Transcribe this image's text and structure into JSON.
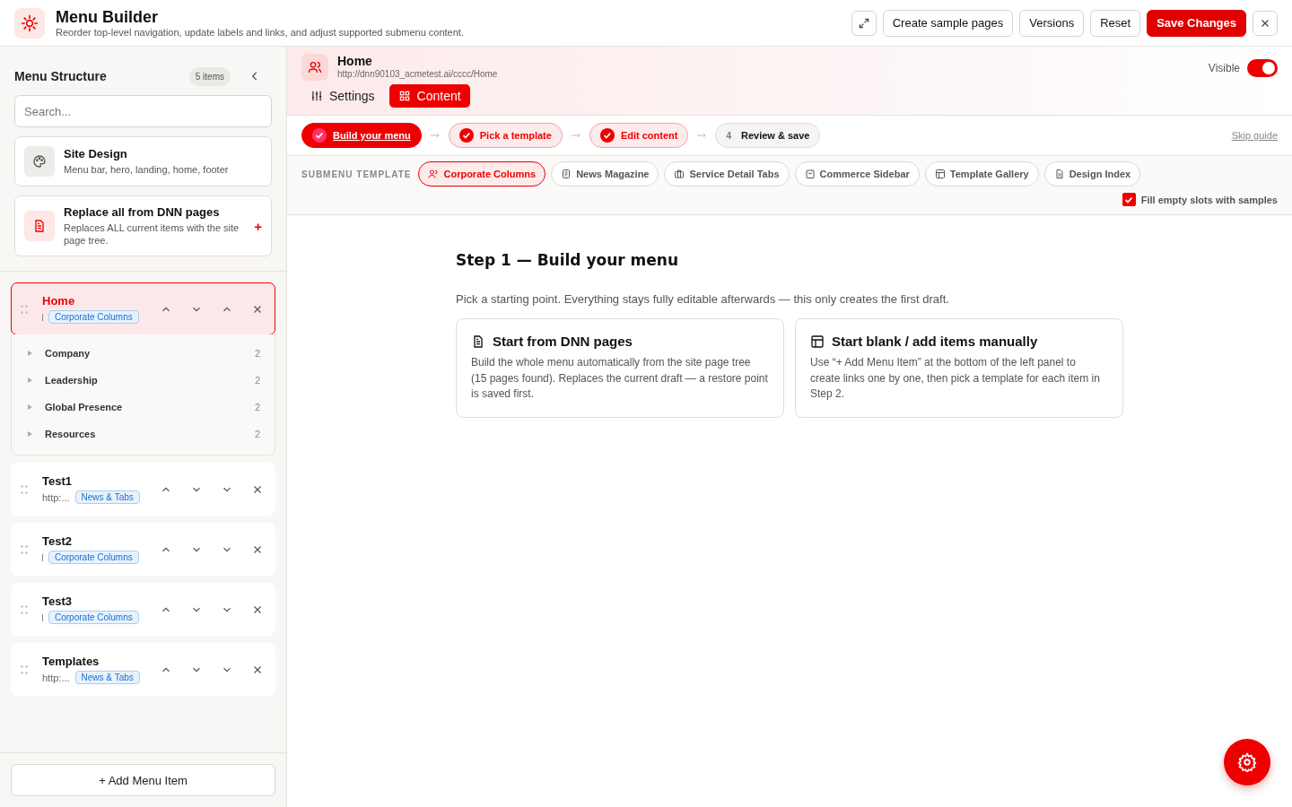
{
  "header": {
    "title": "Menu Builder",
    "subtitle": "Reorder top-level navigation, update labels and links, and adjust supported submenu content.",
    "buttons": [
      {
        "label": "Create sample pages",
        "kind": "plain"
      },
      {
        "label": "Versions",
        "kind": "plain"
      },
      {
        "label": "Reset",
        "kind": "plain"
      },
      {
        "label": "Save Changes",
        "kind": "primary"
      }
    ]
  },
  "sidebar": {
    "title": "Menu Structure",
    "count": "5 items",
    "search": {
      "placeholder": "Search..."
    },
    "cards": [
      {
        "title": "Site Design",
        "text": "Menu bar, hero, landing, home, footer",
        "kind": "design"
      },
      {
        "title": "Replace all from DNN pages",
        "text": "Replaces ALL current items with the site page tree.",
        "kind": "replace",
        "action": "+"
      }
    ],
    "items": [
      {
        "label": "Home",
        "template": "Corporate Columns",
        "selected": true,
        "expanded": true,
        "children": [
          {
            "label": "Company",
            "count": "2"
          },
          {
            "label": "Leadership",
            "count": "2"
          },
          {
            "label": "Global Presence",
            "count": "2"
          },
          {
            "label": "Resources",
            "count": "2"
          }
        ]
      },
      {
        "label": "Test1",
        "url": "http:...",
        "template": "News & Tabs",
        "selected": false,
        "expanded": false
      },
      {
        "label": "Test2",
        "template": "Corporate Columns",
        "selected": false,
        "expanded": false
      },
      {
        "label": "Test3",
        "template": "Corporate Columns",
        "selected": false,
        "expanded": false
      },
      {
        "label": "Templates",
        "url": "http:...",
        "template": "News & Tabs",
        "selected": false,
        "expanded": false
      }
    ],
    "add_button": "+ Add Menu Item"
  },
  "editor": {
    "title": "Home",
    "url": "http://dnn90103_acmetest.ai/cccc/Home",
    "visible_label": "Visible",
    "visible": true,
    "tabs": [
      {
        "label": "Settings",
        "selected": false
      },
      {
        "label": "Content",
        "selected": true
      }
    ],
    "steps": [
      {
        "label": "Build your menu",
        "kind": "current"
      },
      {
        "label": "Pick a template",
        "kind": "done"
      },
      {
        "label": "Edit content",
        "kind": "done"
      },
      {
        "label": "Review & save",
        "kind": "todo",
        "number": "4"
      }
    ],
    "skip": "Skip guide",
    "template_label": "SUBMENU TEMPLATE",
    "templates": [
      {
        "label": "Corporate Columns",
        "selected": true
      },
      {
        "label": "News Magazine",
        "selected": false
      },
      {
        "label": "Service Detail Tabs",
        "selected": false
      },
      {
        "label": "Commerce Sidebar",
        "selected": false
      },
      {
        "label": "Template Gallery",
        "selected": false
      },
      {
        "label": "Design Index",
        "selected": false
      }
    ],
    "fill_samples": {
      "label": "Fill empty slots with samples",
      "checked": true
    },
    "step_title": "Step 1 — Build your menu",
    "step_text": "Pick a starting point. Everything stays fully editable afterwards — this only creates the first draft.",
    "options": [
      {
        "title": "Start from DNN pages",
        "text": "Build the whole menu automatically from the site page tree (15 pages found). Replaces the current draft — a restore point is saved first."
      },
      {
        "title": "Start blank / add items manually",
        "text": "Use “+ Add Menu Item” at the bottom of the left panel to create links one by one, then pick a template for each item in Step 2."
      }
    ]
  }
}
